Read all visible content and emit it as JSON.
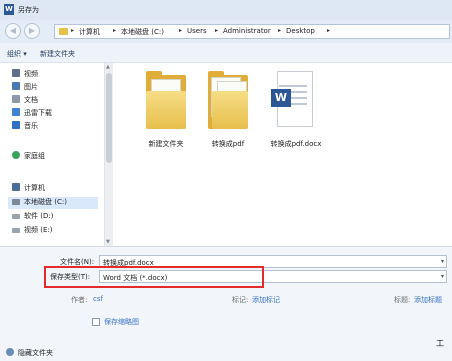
{
  "window": {
    "title": "另存为",
    "app_icon": "W"
  },
  "address": {
    "breadcrumbs": [
      "计算机",
      "本地磁盘 (C:)",
      "Users",
      "Administrator",
      "Desktop"
    ]
  },
  "toolbar": {
    "organize": "组织 ▾",
    "new_folder": "新建文件夹"
  },
  "sidebar": {
    "items": [
      {
        "label": "视频",
        "icon": "video-icon",
        "color": "#5b6f8c"
      },
      {
        "label": "图片",
        "icon": "picture-icon",
        "color": "#4b7ab3"
      },
      {
        "label": "文档",
        "icon": "document-icon",
        "color": "#8c98aa"
      },
      {
        "label": "迅雷下载",
        "icon": "thunder-download-icon",
        "color": "#3f82d6"
      },
      {
        "label": "音乐",
        "icon": "music-icon",
        "color": "#2f6fc5"
      },
      {
        "label": "家庭组",
        "icon": "homegroup-icon",
        "color": "#3aa35b"
      },
      {
        "label": "计算机",
        "icon": "computer-icon",
        "color": "#4a6e9c"
      },
      {
        "label": "本地磁盘 (C:)",
        "icon": "drive-c-icon",
        "color": "#7c8896"
      },
      {
        "label": "软件 (D:)",
        "icon": "drive-d-icon",
        "color": "#9aa3ad"
      },
      {
        "label": "视频 (E:)",
        "icon": "drive-e-icon",
        "color": "#9aa3ad"
      }
    ]
  },
  "files": [
    {
      "name": "新建文件夹",
      "icon": "folder-icon"
    },
    {
      "name": "转换成pdf",
      "icon": "folder-with-documents-icon"
    },
    {
      "name": "转换成pdf.docx",
      "icon": "word-document-icon"
    }
  ],
  "form": {
    "filename_label": "文件名(N):",
    "filename_value": "转换成pdf.docx",
    "savetype_label": "保存类型(T):",
    "savetype_value": "Word 文档 (*.docx)",
    "author_label": "作者:",
    "author_value": "csf",
    "tags_label": "标记:",
    "tags_value": "添加标记",
    "title_label": "标题:",
    "title_value": "添加标题",
    "thumbnail_label": "保存缩略图"
  },
  "footer": {
    "hide_folders": "隐藏文件夹",
    "tools": "工"
  },
  "colors": {
    "highlight_box": "#e32b2b",
    "link": "#3572c8",
    "selected_row": "#d9e8fb"
  }
}
